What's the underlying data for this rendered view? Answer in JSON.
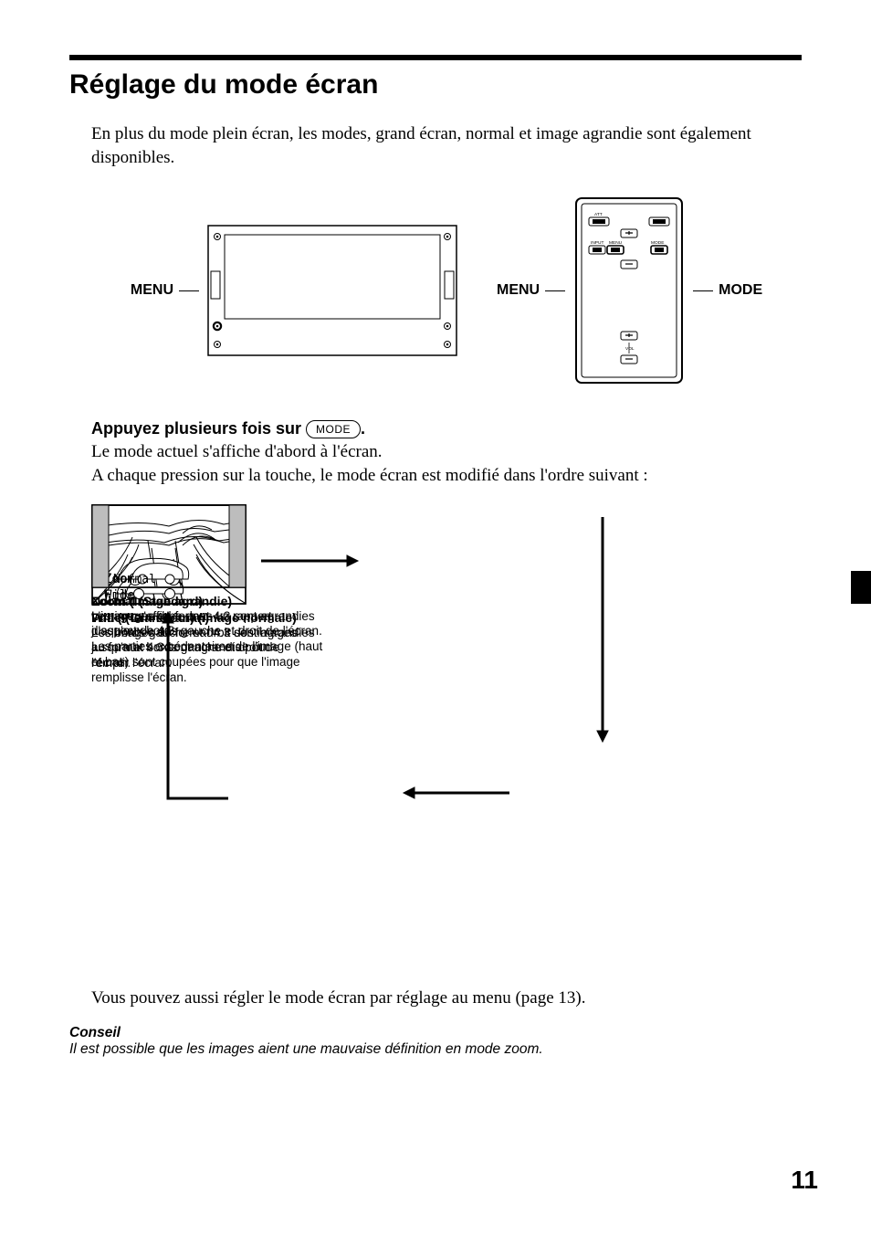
{
  "title": "Réglage du mode écran",
  "intro": "En plus du mode plein écran, les modes, grand écran, normal et image agrandie sont également disponibles.",
  "labels": {
    "menu": "MENU",
    "mode": "MODE"
  },
  "remote_indicators": {
    "att": "ATT",
    "input": "INPUT",
    "menu": "MENU",
    "mode": "MODE",
    "vol": "VOL"
  },
  "instruction": {
    "head_prefix": "Appuyez plusieurs fois sur ",
    "mode_button": "MODE",
    "head_suffix": ".",
    "line1": "Le mode actuel s'affiche d'abord à l'écran.",
    "line2": "A chaque pression sur la touche, le mode écran est modifié dans l'ordre suivant :"
  },
  "modes": {
    "full": {
      "badge": "Full",
      "title": "Full (Plein écran) (image normale)",
      "desc": "Les images de format 4:3 sont agrandies jusqu'aux bords gauche et droit de l'écran."
    },
    "wide": {
      "badge": "Wide",
      "title": "Wide (Grand écran)",
      "desc": "Les bords gauche et droit des images au format 4:3 sont agrandis pour remplir l'écran."
    },
    "zoom": {
      "badge": "Zoom",
      "title": "Zoom (Image agrandie)",
      "desc": "Les images de format 4:3 sont agrandies jusqu'aux bords gauche et droit de l'écran. Les parties excédentaires de l'image (haut et bas) sont coupées pour que l'image remplisse l'écran."
    },
    "normal": {
      "badge": "Normal",
      "title": "Normal (Standard)",
      "desc": "L'image s'affiche dans un rapport d'aspect de 4:3."
    }
  },
  "closing": "Vous pouvez aussi régler le mode écran par réglage au menu (page 13).",
  "tip": {
    "head": "Conseil",
    "body": "Il est possible que les images aient une mauvaise définition en mode zoom."
  },
  "page_number": "11"
}
